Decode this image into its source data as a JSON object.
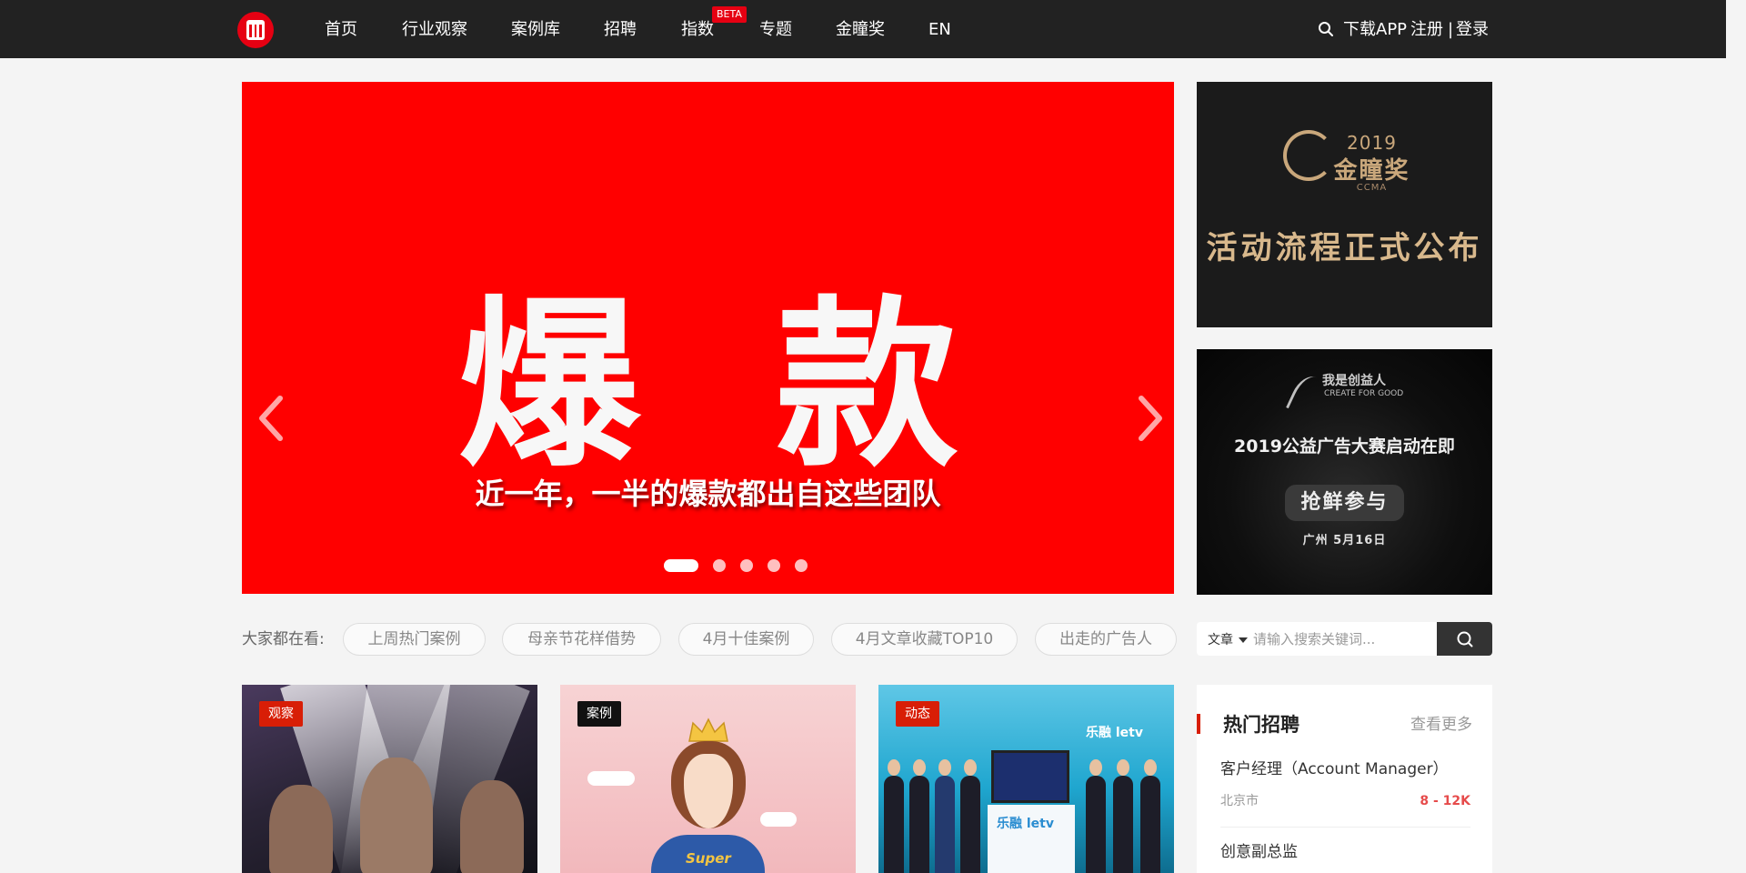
{
  "nav": {
    "items": [
      "首页",
      "行业观察",
      "案例库",
      "招聘",
      "指数",
      "专题",
      "金瞳奖",
      "EN"
    ],
    "beta_badge": "BETA",
    "download": "下载APP",
    "register": "注册",
    "separator": "|",
    "login": "登录"
  },
  "hero": {
    "title": "爆 款",
    "subtitle": "近一年，一半的爆款都出自这些团队",
    "slide_count": 5,
    "active_slide": 1
  },
  "ads": {
    "ad1": {
      "year": "2019",
      "name": "金瞳奖",
      "sub": "CCMA",
      "headline": "活动流程正式公布"
    },
    "ad2": {
      "brand": "我是创益人",
      "brand_en": "CREATE FOR GOOD",
      "headline": "2019公益广告大赛启动在即",
      "button": "抢鲜参与",
      "place": "广州   5月16日"
    }
  },
  "trending": {
    "label": "大家都在看:",
    "tags": [
      "上周热门案例",
      "母亲节花样借势",
      "4月十佳案例",
      "4月文章收藏TOP10",
      "出走的广告人"
    ]
  },
  "search": {
    "type": "文章",
    "placeholder": "请输入搜索关键词..."
  },
  "cards": [
    {
      "tag": "观察"
    },
    {
      "tag": "案例",
      "image_text": "Super"
    },
    {
      "tag": "动态",
      "image_text": "乐融 letv"
    }
  ],
  "jobs": {
    "title": "热门招聘",
    "more": "查看更多",
    "items": [
      {
        "title": "客户经理（Account Manager）",
        "city": "北京市",
        "salary": "8 - 12K"
      },
      {
        "title": "创意副总监"
      }
    ]
  },
  "colors": {
    "brand_red": "#e60012",
    "topbar": "#222222",
    "hero_bg": "#ff0000",
    "salary": "#e64b4b",
    "gold": "#c9a77b"
  },
  "icons": [
    "logo-icon",
    "search-icon",
    "chevron-left-icon",
    "chevron-right-icon",
    "caret-down-icon",
    "search-button-icon"
  ]
}
